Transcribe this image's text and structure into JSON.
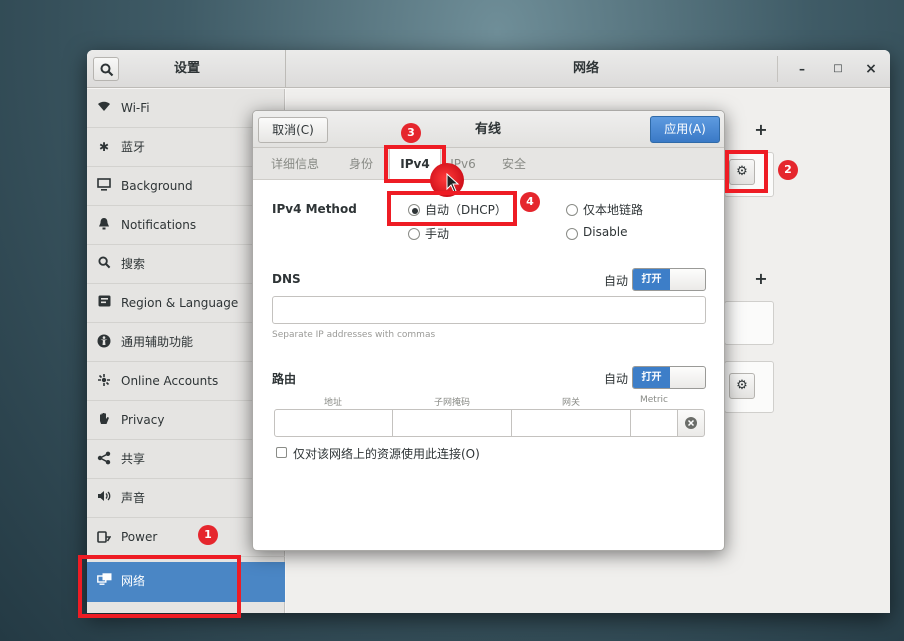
{
  "window": {
    "left_title": "设置",
    "main_title": "网络",
    "minimize_glyph": "–",
    "maximize_glyph": "□",
    "close_glyph": "×"
  },
  "sidebar": {
    "items": [
      {
        "label": "Wi-Fi",
        "icon": "wifi-icon"
      },
      {
        "label": "蓝牙",
        "icon": "bluetooth-icon"
      },
      {
        "label": "Background",
        "icon": "background-icon"
      },
      {
        "label": "Notifications",
        "icon": "bell-icon"
      },
      {
        "label": "搜索",
        "icon": "search-icon"
      },
      {
        "label": "Region & Language",
        "icon": "region-icon"
      },
      {
        "label": "通用辅助功能",
        "icon": "accessibility-icon"
      },
      {
        "label": "Online Accounts",
        "icon": "online-accounts-icon"
      },
      {
        "label": "Privacy",
        "icon": "hand-icon"
      },
      {
        "label": "共享",
        "icon": "share-icon"
      },
      {
        "label": "声音",
        "icon": "speaker-icon"
      },
      {
        "label": "Power",
        "icon": "power-icon"
      },
      {
        "label": "网络",
        "icon": "network-icon",
        "active": true
      }
    ]
  },
  "content": {
    "add_glyph": "+",
    "gear_glyph": "⚙"
  },
  "dialog": {
    "cancel_label": "取消(C)",
    "title": "有线",
    "apply_label": "应用(A)",
    "tabs": [
      {
        "label": "详细信息"
      },
      {
        "label": "身份"
      },
      {
        "label": "IPv4",
        "active": true
      },
      {
        "label": "IPv6"
      },
      {
        "label": "安全"
      }
    ],
    "ipv4_method_label": "IPv4 Method",
    "methods": {
      "auto_dhcp": "自动（DHCP）",
      "manual": "手动",
      "link_local": "仅本地链路",
      "disable": "Disable",
      "selected": "auto_dhcp"
    },
    "dns": {
      "label": "DNS",
      "auto_label": "自动",
      "switch_on_label": "打开",
      "value": "",
      "hint": "Separate IP addresses with commas"
    },
    "routes": {
      "label": "路由",
      "auto_label": "自动",
      "switch_on_label": "打开",
      "columns": [
        "地址",
        "子网掩码",
        "网关",
        "Metric"
      ]
    },
    "checkbox_label": "仅对该网络上的资源使用此连接(O)"
  },
  "annotations": {
    "badges": [
      "1",
      "2",
      "3",
      "4"
    ],
    "color": "#ee1c24"
  }
}
